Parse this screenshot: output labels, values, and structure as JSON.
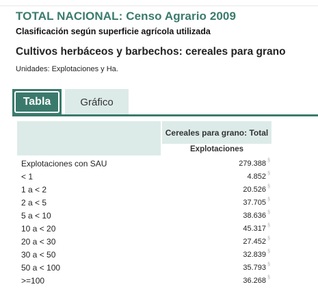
{
  "page": {
    "title": "TOTAL NACIONAL: Censo Agrario 2009",
    "subtitle": "Clasificación según superficie agrícola utilizada",
    "section_title": "Cultivos herbáceos y barbechos: cereales para grano",
    "units": "Unidades: Explotaciones y Ha."
  },
  "tabs": [
    {
      "label": "Tabla",
      "active": true
    },
    {
      "label": "Gráfico",
      "active": false
    }
  ],
  "table": {
    "column_header": "Cereales para grano: Total",
    "subheader": "Explotaciones",
    "rows": [
      {
        "label": "Explotaciones con SAU",
        "value": "279.388"
      },
      {
        "label": "< 1",
        "value": "4.852"
      },
      {
        "label": "1 a < 2",
        "value": "20.526"
      },
      {
        "label": "2 a < 5",
        "value": "37.705"
      },
      {
        "label": "5 a < 10",
        "value": "38.636"
      },
      {
        "label": "10 a < 20",
        "value": "45.317"
      },
      {
        "label": "20 a < 30",
        "value": "27.452"
      },
      {
        "label": "30 a < 50",
        "value": "32.839"
      },
      {
        "label": "50 a < 100",
        "value": "35.793"
      },
      {
        "label": ">=100",
        "value": "36.268"
      }
    ],
    "note_glyph": "§"
  },
  "colors": {
    "accent": "#3a7a6c",
    "header_bg": "#dcebe8"
  }
}
